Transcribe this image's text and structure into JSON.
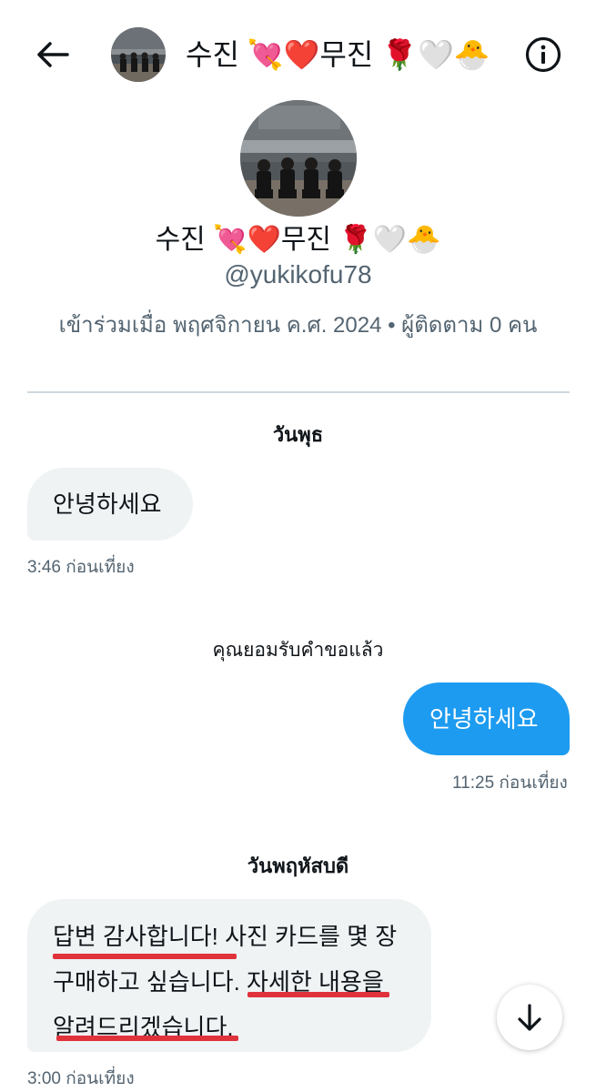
{
  "header": {
    "title": "수진 💘❤️무진 🌹🤍🐣"
  },
  "profile": {
    "name": "수진 💘❤️무진 🌹🤍🐣",
    "handle": "@yukikofu78",
    "meta": "เข้าร่วมเมื่อ พฤศจิกายน ค.ศ. 2024 • ผู้ติดตาม 0 คน"
  },
  "conversation": {
    "day1": "วันพุธ",
    "msg1": {
      "text": "안녕하세요",
      "time": "3:46 ก่อนเที่ยง"
    },
    "accepted_note": "คุณยอมรับคำขอแล้ว",
    "msg2": {
      "text": "안녕하세요",
      "time": "11:25 ก่อนเที่ยง"
    },
    "day2": "วันพฤหัสบดี",
    "msg3": {
      "line1": "답변 감사합니다! 사진 카드를 몇 장",
      "line2": "구매하고 싶습니다. 자세한 내용을",
      "line3": "알려드리겠습니다.",
      "time": "3:00 ก่อนเที่ยง"
    }
  },
  "icons": {
    "back": "arrow-left-icon",
    "info": "info-circle-icon",
    "scroll": "arrow-down-icon"
  },
  "colors": {
    "accent": "#1d9bf0",
    "incoming_bubble": "#eff3f4",
    "highlight_underline": "#e0323b"
  }
}
